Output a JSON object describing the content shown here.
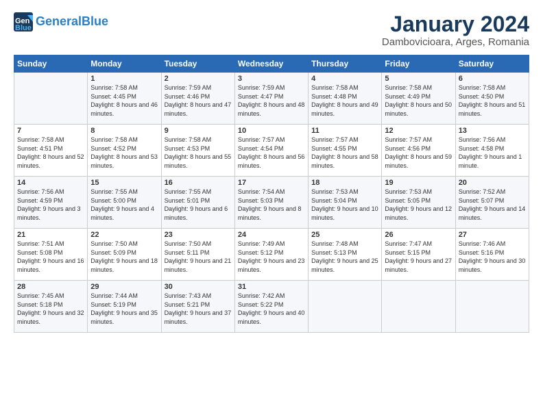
{
  "logo": {
    "line1": "General",
    "line2": "Blue"
  },
  "title": "January 2024",
  "subtitle": "Dambovicioara, Arges, Romania",
  "header": {
    "days": [
      "Sunday",
      "Monday",
      "Tuesday",
      "Wednesday",
      "Thursday",
      "Friday",
      "Saturday"
    ]
  },
  "weeks": [
    [
      {
        "num": "",
        "sunrise": "",
        "sunset": "",
        "daylight": ""
      },
      {
        "num": "1",
        "sunrise": "Sunrise: 7:58 AM",
        "sunset": "Sunset: 4:45 PM",
        "daylight": "Daylight: 8 hours and 46 minutes."
      },
      {
        "num": "2",
        "sunrise": "Sunrise: 7:59 AM",
        "sunset": "Sunset: 4:46 PM",
        "daylight": "Daylight: 8 hours and 47 minutes."
      },
      {
        "num": "3",
        "sunrise": "Sunrise: 7:59 AM",
        "sunset": "Sunset: 4:47 PM",
        "daylight": "Daylight: 8 hours and 48 minutes."
      },
      {
        "num": "4",
        "sunrise": "Sunrise: 7:58 AM",
        "sunset": "Sunset: 4:48 PM",
        "daylight": "Daylight: 8 hours and 49 minutes."
      },
      {
        "num": "5",
        "sunrise": "Sunrise: 7:58 AM",
        "sunset": "Sunset: 4:49 PM",
        "daylight": "Daylight: 8 hours and 50 minutes."
      },
      {
        "num": "6",
        "sunrise": "Sunrise: 7:58 AM",
        "sunset": "Sunset: 4:50 PM",
        "daylight": "Daylight: 8 hours and 51 minutes."
      }
    ],
    [
      {
        "num": "7",
        "sunrise": "Sunrise: 7:58 AM",
        "sunset": "Sunset: 4:51 PM",
        "daylight": "Daylight: 8 hours and 52 minutes."
      },
      {
        "num": "8",
        "sunrise": "Sunrise: 7:58 AM",
        "sunset": "Sunset: 4:52 PM",
        "daylight": "Daylight: 8 hours and 53 minutes."
      },
      {
        "num": "9",
        "sunrise": "Sunrise: 7:58 AM",
        "sunset": "Sunset: 4:53 PM",
        "daylight": "Daylight: 8 hours and 55 minutes."
      },
      {
        "num": "10",
        "sunrise": "Sunrise: 7:57 AM",
        "sunset": "Sunset: 4:54 PM",
        "daylight": "Daylight: 8 hours and 56 minutes."
      },
      {
        "num": "11",
        "sunrise": "Sunrise: 7:57 AM",
        "sunset": "Sunset: 4:55 PM",
        "daylight": "Daylight: 8 hours and 58 minutes."
      },
      {
        "num": "12",
        "sunrise": "Sunrise: 7:57 AM",
        "sunset": "Sunset: 4:56 PM",
        "daylight": "Daylight: 8 hours and 59 minutes."
      },
      {
        "num": "13",
        "sunrise": "Sunrise: 7:56 AM",
        "sunset": "Sunset: 4:58 PM",
        "daylight": "Daylight: 9 hours and 1 minute."
      }
    ],
    [
      {
        "num": "14",
        "sunrise": "Sunrise: 7:56 AM",
        "sunset": "Sunset: 4:59 PM",
        "daylight": "Daylight: 9 hours and 3 minutes."
      },
      {
        "num": "15",
        "sunrise": "Sunrise: 7:55 AM",
        "sunset": "Sunset: 5:00 PM",
        "daylight": "Daylight: 9 hours and 4 minutes."
      },
      {
        "num": "16",
        "sunrise": "Sunrise: 7:55 AM",
        "sunset": "Sunset: 5:01 PM",
        "daylight": "Daylight: 9 hours and 6 minutes."
      },
      {
        "num": "17",
        "sunrise": "Sunrise: 7:54 AM",
        "sunset": "Sunset: 5:03 PM",
        "daylight": "Daylight: 9 hours and 8 minutes."
      },
      {
        "num": "18",
        "sunrise": "Sunrise: 7:53 AM",
        "sunset": "Sunset: 5:04 PM",
        "daylight": "Daylight: 9 hours and 10 minutes."
      },
      {
        "num": "19",
        "sunrise": "Sunrise: 7:53 AM",
        "sunset": "Sunset: 5:05 PM",
        "daylight": "Daylight: 9 hours and 12 minutes."
      },
      {
        "num": "20",
        "sunrise": "Sunrise: 7:52 AM",
        "sunset": "Sunset: 5:07 PM",
        "daylight": "Daylight: 9 hours and 14 minutes."
      }
    ],
    [
      {
        "num": "21",
        "sunrise": "Sunrise: 7:51 AM",
        "sunset": "Sunset: 5:08 PM",
        "daylight": "Daylight: 9 hours and 16 minutes."
      },
      {
        "num": "22",
        "sunrise": "Sunrise: 7:50 AM",
        "sunset": "Sunset: 5:09 PM",
        "daylight": "Daylight: 9 hours and 18 minutes."
      },
      {
        "num": "23",
        "sunrise": "Sunrise: 7:50 AM",
        "sunset": "Sunset: 5:11 PM",
        "daylight": "Daylight: 9 hours and 21 minutes."
      },
      {
        "num": "24",
        "sunrise": "Sunrise: 7:49 AM",
        "sunset": "Sunset: 5:12 PM",
        "daylight": "Daylight: 9 hours and 23 minutes."
      },
      {
        "num": "25",
        "sunrise": "Sunrise: 7:48 AM",
        "sunset": "Sunset: 5:13 PM",
        "daylight": "Daylight: 9 hours and 25 minutes."
      },
      {
        "num": "26",
        "sunrise": "Sunrise: 7:47 AM",
        "sunset": "Sunset: 5:15 PM",
        "daylight": "Daylight: 9 hours and 27 minutes."
      },
      {
        "num": "27",
        "sunrise": "Sunrise: 7:46 AM",
        "sunset": "Sunset: 5:16 PM",
        "daylight": "Daylight: 9 hours and 30 minutes."
      }
    ],
    [
      {
        "num": "28",
        "sunrise": "Sunrise: 7:45 AM",
        "sunset": "Sunset: 5:18 PM",
        "daylight": "Daylight: 9 hours and 32 minutes."
      },
      {
        "num": "29",
        "sunrise": "Sunrise: 7:44 AM",
        "sunset": "Sunset: 5:19 PM",
        "daylight": "Daylight: 9 hours and 35 minutes."
      },
      {
        "num": "30",
        "sunrise": "Sunrise: 7:43 AM",
        "sunset": "Sunset: 5:21 PM",
        "daylight": "Daylight: 9 hours and 37 minutes."
      },
      {
        "num": "31",
        "sunrise": "Sunrise: 7:42 AM",
        "sunset": "Sunset: 5:22 PM",
        "daylight": "Daylight: 9 hours and 40 minutes."
      },
      {
        "num": "",
        "sunrise": "",
        "sunset": "",
        "daylight": ""
      },
      {
        "num": "",
        "sunrise": "",
        "sunset": "",
        "daylight": ""
      },
      {
        "num": "",
        "sunrise": "",
        "sunset": "",
        "daylight": ""
      }
    ]
  ]
}
